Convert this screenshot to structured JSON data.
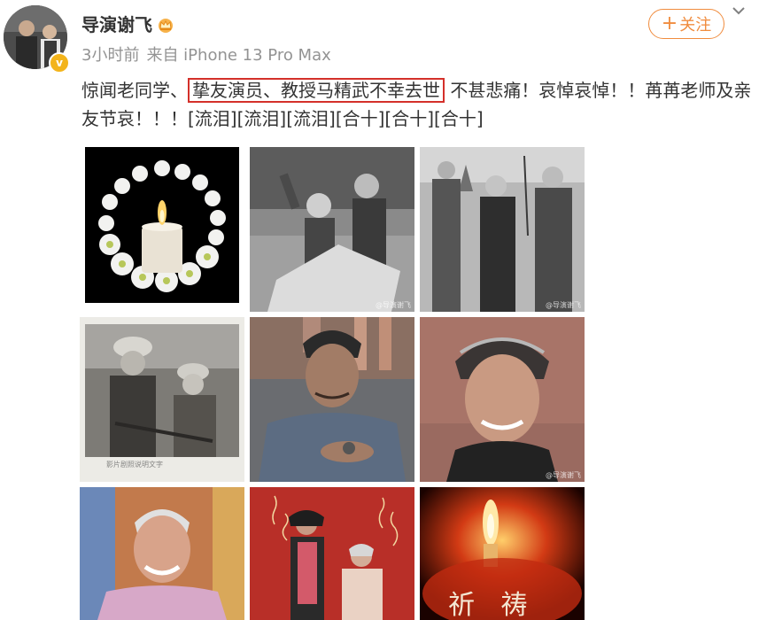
{
  "user": {
    "name": "导演谢飞",
    "avatar": "avatar-photo",
    "verified_icon": "v-badge-icon",
    "badge_icon": "crown-icon"
  },
  "meta": {
    "time": "3小时前",
    "source": "来自 iPhone 13 Pro Max"
  },
  "follow_button": {
    "label": "关注",
    "plus": "+"
  },
  "post": {
    "before": "惊闻老同学、",
    "highlight": "挚友演员、教授马精武不幸去世",
    "after": " 不甚悲痛！哀悼哀悼！！苒苒老师及亲友节哀！！！[流泪][流泪][流泪][合十][合十][合十]"
  },
  "images": {
    "caption_text": "影片剧照说明文字",
    "watermark": "@导演谢飞",
    "prayer_text": "祈 祷"
  },
  "colors": {
    "accent": "#f08c3e",
    "highlight_border": "#d4302a",
    "meta_gray": "#939393"
  }
}
